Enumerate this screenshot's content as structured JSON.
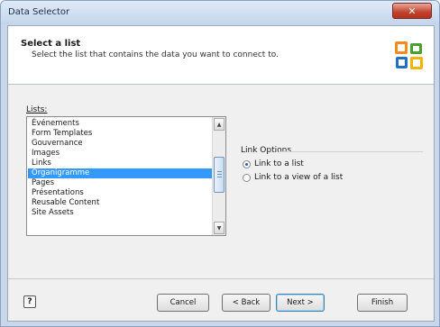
{
  "window": {
    "title": "Data Selector"
  },
  "header": {
    "title": "Select a list",
    "description": "Select the list that contains the data you want to connect to.",
    "icon": "office-logo-icon"
  },
  "lists": {
    "label": "Lists:",
    "items": [
      "Événements",
      "Form Templates",
      "Gouvernance",
      "Images",
      "Links",
      "Organigramme",
      "Pages",
      "Présentations",
      "Reusable Content",
      "Site Assets"
    ],
    "selected": "Organigramme"
  },
  "link_options": {
    "title": "Link Options",
    "options": [
      {
        "label": "Link to a list",
        "selected": true
      },
      {
        "label": "Link to a view of a list",
        "selected": false
      }
    ]
  },
  "footer": {
    "help_label": "?",
    "cancel": "Cancel",
    "back": "< Back",
    "next": "Next >",
    "finish": "Finish"
  },
  "colors": {
    "selection": "#3399ff",
    "close": "#c2412c"
  }
}
